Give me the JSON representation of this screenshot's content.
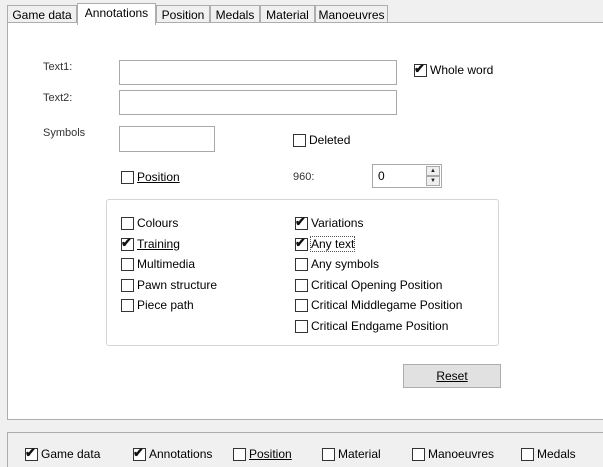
{
  "tabs": [
    {
      "label": "Game data",
      "active": false
    },
    {
      "label": "Annotations",
      "active": true
    },
    {
      "label": "Position",
      "active": false
    },
    {
      "label": "Medals",
      "active": false
    },
    {
      "label": "Material",
      "active": false
    },
    {
      "label": "Manoeuvres",
      "active": false
    }
  ],
  "form": {
    "text1_label": "Text1:",
    "text1_value": "",
    "text2_label": "Text2:",
    "text2_value": "",
    "symbols_label": "Symbols",
    "symbols_value": "",
    "whole_word": {
      "label": "Whole word",
      "checked": true
    },
    "deleted": {
      "label": "Deleted",
      "checked": false
    },
    "position": {
      "label": "Position",
      "checked": false
    },
    "960_label": "960:",
    "960_value": "0"
  },
  "group": {
    "left": [
      {
        "label": "Colours",
        "checked": false
      },
      {
        "label": "Training",
        "checked": true
      },
      {
        "label": "Multimedia",
        "checked": false
      },
      {
        "label": "Pawn structure",
        "checked": false
      },
      {
        "label": "Piece path",
        "checked": false
      }
    ],
    "right": [
      {
        "label": "Variations",
        "checked": true
      },
      {
        "label": "Any text",
        "checked": true
      },
      {
        "label": "Any symbols",
        "checked": false
      },
      {
        "label": "Critical Opening Position",
        "checked": false
      },
      {
        "label": "Critical Middlegame Position",
        "checked": false
      },
      {
        "label": "Critical Endgame Position",
        "checked": false
      }
    ]
  },
  "reset_button": "Reset",
  "bottom": [
    {
      "label": "Game data",
      "checked": true
    },
    {
      "label": "Annotations",
      "checked": true
    },
    {
      "label": "Position",
      "checked": false
    },
    {
      "label": "Material",
      "checked": false
    },
    {
      "label": "Manoeuvres",
      "checked": false
    },
    {
      "label": "Medals",
      "checked": false
    }
  ]
}
